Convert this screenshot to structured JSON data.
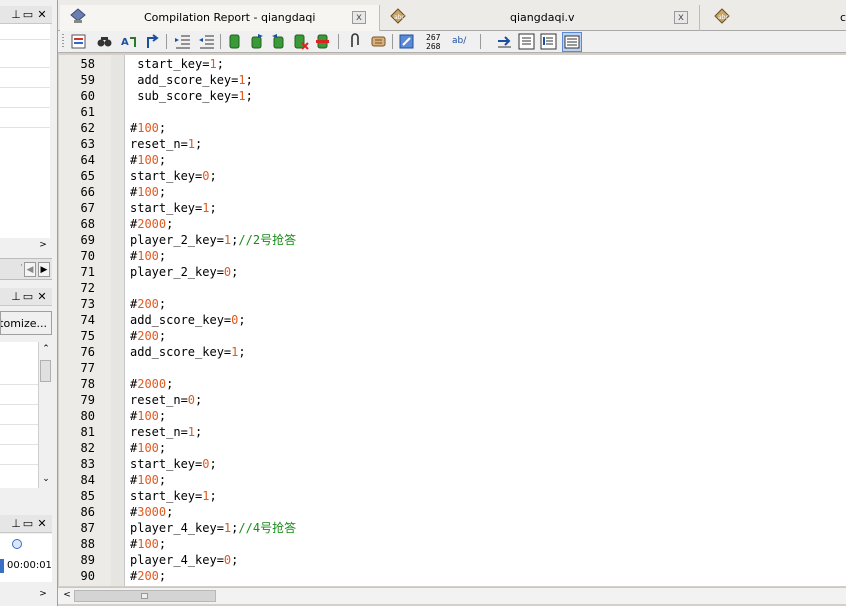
{
  "tabs": [
    {
      "title": "Compilation Report - qiangdaqi",
      "close": "x"
    },
    {
      "title": "qiangdaqi.v",
      "close": "x"
    },
    {
      "title": "c"
    }
  ],
  "left_panels": {
    "panel1_buttons": [
      "pin",
      "float",
      "close"
    ],
    "panel2": {
      "customize_label": "stomize...",
      "buttons": [
        "pin",
        "float",
        "close"
      ]
    },
    "panel3": {
      "timer": "00:00:01",
      "buttons": [
        "pin",
        "float",
        "close"
      ]
    }
  },
  "toolbar": {
    "line_col_top": "267",
    "line_col_bottom": "268",
    "ab_label": "ab/"
  },
  "code_lines": [
    {
      "n": "58",
      "parts": [
        {
          "t": " start_key=",
          "c": ""
        },
        {
          "t": "1",
          "c": "num"
        },
        {
          "t": ";",
          "c": ""
        }
      ]
    },
    {
      "n": "59",
      "parts": [
        {
          "t": " add_score_key=",
          "c": ""
        },
        {
          "t": "1",
          "c": "num"
        },
        {
          "t": ";",
          "c": ""
        }
      ]
    },
    {
      "n": "60",
      "parts": [
        {
          "t": " sub_score_key=",
          "c": ""
        },
        {
          "t": "1",
          "c": "num"
        },
        {
          "t": ";",
          "c": ""
        }
      ]
    },
    {
      "n": "61",
      "parts": []
    },
    {
      "n": "62",
      "parts": [
        {
          "t": "#",
          "c": ""
        },
        {
          "t": "100",
          "c": "num"
        },
        {
          "t": ";",
          "c": ""
        }
      ]
    },
    {
      "n": "63",
      "parts": [
        {
          "t": "reset_n=",
          "c": ""
        },
        {
          "t": "1",
          "c": "num"
        },
        {
          "t": ";",
          "c": ""
        }
      ]
    },
    {
      "n": "64",
      "parts": [
        {
          "t": "#",
          "c": ""
        },
        {
          "t": "100",
          "c": "num"
        },
        {
          "t": ";",
          "c": ""
        }
      ]
    },
    {
      "n": "65",
      "parts": [
        {
          "t": "start_key=",
          "c": ""
        },
        {
          "t": "0",
          "c": "num"
        },
        {
          "t": ";",
          "c": ""
        }
      ]
    },
    {
      "n": "66",
      "parts": [
        {
          "t": "#",
          "c": ""
        },
        {
          "t": "100",
          "c": "num"
        },
        {
          "t": ";",
          "c": ""
        }
      ]
    },
    {
      "n": "67",
      "parts": [
        {
          "t": "start_key=",
          "c": ""
        },
        {
          "t": "1",
          "c": "num"
        },
        {
          "t": ";",
          "c": ""
        }
      ]
    },
    {
      "n": "68",
      "parts": [
        {
          "t": "#",
          "c": ""
        },
        {
          "t": "2000",
          "c": "num"
        },
        {
          "t": ";",
          "c": ""
        }
      ]
    },
    {
      "n": "69",
      "parts": [
        {
          "t": "player_2_key=",
          "c": ""
        },
        {
          "t": "1",
          "c": "num"
        },
        {
          "t": ";",
          "c": ""
        },
        {
          "t": "//2号抢答",
          "c": "cmt"
        }
      ]
    },
    {
      "n": "70",
      "parts": [
        {
          "t": "#",
          "c": ""
        },
        {
          "t": "100",
          "c": "num"
        },
        {
          "t": ";",
          "c": ""
        }
      ]
    },
    {
      "n": "71",
      "parts": [
        {
          "t": "player_2_key=",
          "c": ""
        },
        {
          "t": "0",
          "c": "num"
        },
        {
          "t": ";",
          "c": ""
        }
      ]
    },
    {
      "n": "72",
      "parts": []
    },
    {
      "n": "73",
      "parts": [
        {
          "t": "#",
          "c": ""
        },
        {
          "t": "200",
          "c": "num"
        },
        {
          "t": ";",
          "c": ""
        }
      ]
    },
    {
      "n": "74",
      "parts": [
        {
          "t": "add_score_key=",
          "c": ""
        },
        {
          "t": "0",
          "c": "num"
        },
        {
          "t": ";",
          "c": ""
        }
      ]
    },
    {
      "n": "75",
      "parts": [
        {
          "t": "#",
          "c": ""
        },
        {
          "t": "200",
          "c": "num"
        },
        {
          "t": ";",
          "c": ""
        }
      ]
    },
    {
      "n": "76",
      "parts": [
        {
          "t": "add_score_key=",
          "c": ""
        },
        {
          "t": "1",
          "c": "num"
        },
        {
          "t": ";",
          "c": ""
        }
      ]
    },
    {
      "n": "77",
      "parts": []
    },
    {
      "n": "78",
      "parts": [
        {
          "t": "#",
          "c": ""
        },
        {
          "t": "2000",
          "c": "num"
        },
        {
          "t": ";",
          "c": ""
        }
      ]
    },
    {
      "n": "79",
      "parts": [
        {
          "t": "reset_n=",
          "c": ""
        },
        {
          "t": "0",
          "c": "num"
        },
        {
          "t": ";",
          "c": ""
        }
      ]
    },
    {
      "n": "80",
      "parts": [
        {
          "t": "#",
          "c": ""
        },
        {
          "t": "100",
          "c": "num"
        },
        {
          "t": ";",
          "c": ""
        }
      ]
    },
    {
      "n": "81",
      "parts": [
        {
          "t": "reset_n=",
          "c": ""
        },
        {
          "t": "1",
          "c": "num"
        },
        {
          "t": ";",
          "c": ""
        }
      ]
    },
    {
      "n": "82",
      "parts": [
        {
          "t": "#",
          "c": ""
        },
        {
          "t": "100",
          "c": "num"
        },
        {
          "t": ";",
          "c": ""
        }
      ]
    },
    {
      "n": "83",
      "parts": [
        {
          "t": "start_key=",
          "c": ""
        },
        {
          "t": "0",
          "c": "num"
        },
        {
          "t": ";",
          "c": ""
        }
      ]
    },
    {
      "n": "84",
      "parts": [
        {
          "t": "#",
          "c": ""
        },
        {
          "t": "100",
          "c": "num"
        },
        {
          "t": ";",
          "c": ""
        }
      ]
    },
    {
      "n": "85",
      "parts": [
        {
          "t": "start_key=",
          "c": ""
        },
        {
          "t": "1",
          "c": "num"
        },
        {
          "t": ";",
          "c": ""
        }
      ]
    },
    {
      "n": "86",
      "parts": [
        {
          "t": "#",
          "c": ""
        },
        {
          "t": "3000",
          "c": "num"
        },
        {
          "t": ";",
          "c": ""
        }
      ]
    },
    {
      "n": "87",
      "parts": [
        {
          "t": "player_4_key=",
          "c": ""
        },
        {
          "t": "1",
          "c": "num"
        },
        {
          "t": ";",
          "c": ""
        },
        {
          "t": "//4号抢答",
          "c": "cmt"
        }
      ]
    },
    {
      "n": "88",
      "parts": [
        {
          "t": "#",
          "c": ""
        },
        {
          "t": "100",
          "c": "num"
        },
        {
          "t": ";",
          "c": ""
        }
      ]
    },
    {
      "n": "89",
      "parts": [
        {
          "t": "player_4_key=",
          "c": ""
        },
        {
          "t": "0",
          "c": "num"
        },
        {
          "t": ";",
          "c": ""
        }
      ]
    },
    {
      "n": "90",
      "parts": [
        {
          "t": "#",
          "c": ""
        },
        {
          "t": "200",
          "c": "num"
        },
        {
          "t": ";",
          "c": ""
        }
      ]
    }
  ],
  "colors": {
    "number": "#e0591d",
    "comment": "#1a8a1a"
  }
}
